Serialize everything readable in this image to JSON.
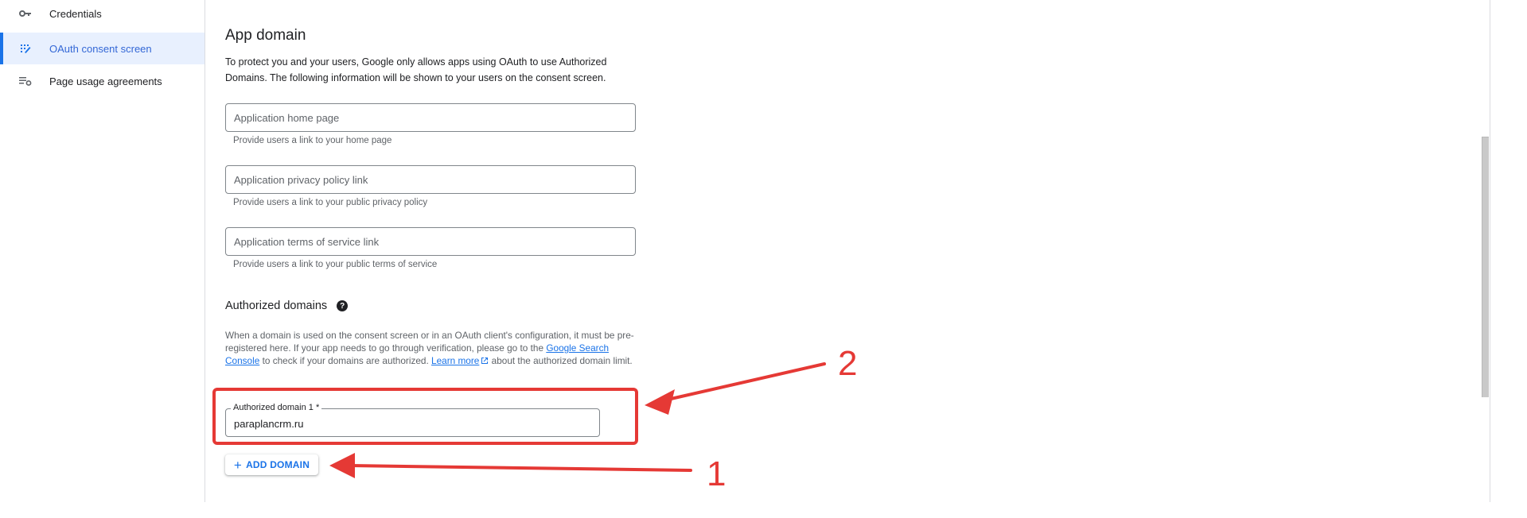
{
  "sidebar": {
    "items": [
      {
        "label": "Credentials",
        "icon": "key-icon",
        "active": false
      },
      {
        "label": "OAuth consent screen",
        "icon": "consent-icon",
        "active": true
      },
      {
        "label": "Page usage agreements",
        "icon": "settings-list-icon",
        "active": false
      }
    ]
  },
  "app_domain": {
    "title": "App domain",
    "description": "To protect you and your users, Google only allows apps using OAuth to use Authorized Domains. The following information will be shown to your users on the consent screen.",
    "fields": [
      {
        "placeholder": "Application home page",
        "value": "",
        "hint": "Provide users a link to your home page"
      },
      {
        "placeholder": "Application privacy policy link",
        "value": "",
        "hint": "Provide users a link to your public privacy policy"
      },
      {
        "placeholder": "Application terms of service link",
        "value": "",
        "hint": "Provide users a link to your public terms of service"
      }
    ]
  },
  "authorized_domains": {
    "title": "Authorized domains",
    "help_icon": "help-icon",
    "description_part1": "When a domain is used on the consent screen or in an OAuth client's configuration, it must be pre-registered here. If your app needs to go through verification, please go to the ",
    "search_console_link": "Google Search Console",
    "description_part2": " to check if your domains are authorized. ",
    "learn_more_link": "Learn more",
    "description_part3": " about the authorized domain limit.",
    "domains": [
      {
        "label": "Authorized domain 1 *",
        "value": "paraplancrm.ru"
      }
    ],
    "add_button": "ADD DOMAIN"
  },
  "annotations": {
    "label_1": "1",
    "label_2": "2",
    "color": "#e53935"
  },
  "colors": {
    "accent": "#1a73e8",
    "active_bg": "#e8f0fe",
    "annotation": "#e53935"
  }
}
